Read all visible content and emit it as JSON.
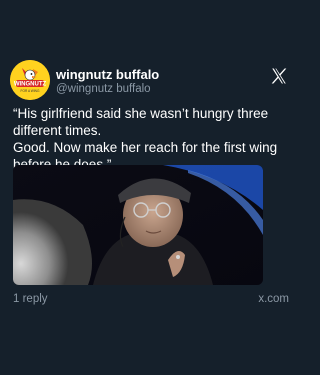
{
  "author": {
    "display_name": "wingnutz buffalo",
    "handle": "@wingnutz buffalo",
    "avatar_text": "WINGNUTZ",
    "avatar_subtext": "FOR A WING"
  },
  "tweet": {
    "lines": [
      "“His girlfriend said she wasn’t hungry three",
      "different times.",
      "Good. Now make her reach for the first wing",
      "before he does.”"
    ]
  },
  "media": {
    "icon": "photo-of-man-in-cap-and-glasses"
  },
  "footer": {
    "replies": "1 reply",
    "source": "x.com"
  },
  "colors": {
    "background": "#15202b",
    "text": "#ffffff",
    "muted": "#8b98a5",
    "avatar_bg": "#ffd21f"
  }
}
